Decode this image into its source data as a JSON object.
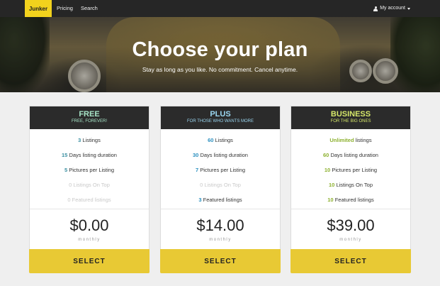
{
  "nav": {
    "brand": "Junker",
    "links": [
      "Pricing",
      "Search"
    ],
    "account_label": "My account"
  },
  "hero": {
    "title": "Choose your plan",
    "subtitle": "Stay as long as you like. No commitment. Cancel anytime."
  },
  "plans": [
    {
      "name": "FREE",
      "tagline": "FREE, FOREVER!",
      "accent": "#a8e6c8",
      "number_color": "#3a8fa1",
      "features": [
        {
          "num": "3",
          "text": "Listings",
          "muted": false
        },
        {
          "num": "15",
          "text": "Days listing duration",
          "muted": false
        },
        {
          "num": "5",
          "text": "Pictures per Listing",
          "muted": false
        },
        {
          "num": "0",
          "text": "Listings On Top",
          "muted": true
        },
        {
          "num": "0",
          "text": "Featured listings",
          "muted": true
        }
      ],
      "price": "$0.00",
      "period": "monthly",
      "button": "SELECT"
    },
    {
      "name": "PLUS",
      "tagline": "FOR THOSE WHO WANTS MORE",
      "accent": "#9ad6f0",
      "number_color": "#2a8fbf",
      "features": [
        {
          "num": "60",
          "text": "Listings",
          "muted": false
        },
        {
          "num": "30",
          "text": "Days listing duration",
          "muted": false
        },
        {
          "num": "7",
          "text": "Pictures per Listing",
          "muted": false
        },
        {
          "num": "0",
          "text": "Listings On Top",
          "muted": true
        },
        {
          "num": "3",
          "text": "Featured listings",
          "muted": false
        }
      ],
      "price": "$14.00",
      "period": "monthly",
      "button": "SELECT"
    },
    {
      "name": "BUSINESS",
      "tagline": "FOR THE BIG ONES",
      "accent": "#d6e86a",
      "number_color": "#8cb02e",
      "features": [
        {
          "num": "Unlimited",
          "text": "listings",
          "muted": false
        },
        {
          "num": "60",
          "text": "Days listing duration",
          "muted": false
        },
        {
          "num": "10",
          "text": "Pictures per Listing",
          "muted": false
        },
        {
          "num": "10",
          "text": "Listings On Top",
          "muted": false
        },
        {
          "num": "10",
          "text": "Featured listings",
          "muted": false
        }
      ],
      "price": "$39.00",
      "period": "monthly",
      "button": "SELECT"
    }
  ],
  "colors": {
    "navbar": "#262626",
    "brand_bg": "#f2d21d",
    "button_bg": "#e8c934",
    "plan_header": "#2b2b2b"
  },
  "icons": {
    "account": "user-icon",
    "account_caret": "caret-down-icon"
  }
}
